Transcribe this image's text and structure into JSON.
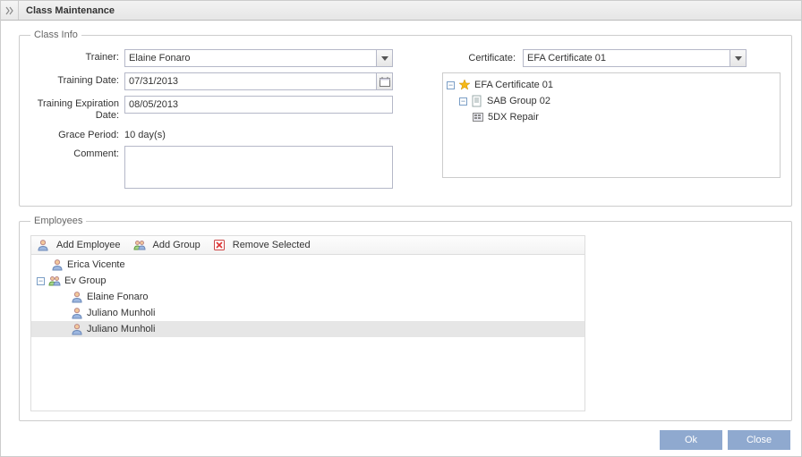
{
  "window": {
    "title": "Class Maintenance"
  },
  "classInfo": {
    "legend": "Class Info",
    "trainer_label": "Trainer:",
    "trainer_value": "Elaine Fonaro",
    "training_date_label": "Training Date:",
    "training_date_value": "07/31/2013",
    "expiry_label": "Training Expiration Date:",
    "expiry_value": "08/05/2013",
    "grace_label": "Grace Period:",
    "grace_value": "10 day(s)",
    "comment_label": "Comment:",
    "comment_value": "",
    "certificate_label": "Certificate:",
    "certificate_value": "EFA Certificate 01",
    "cert_tree": {
      "root": "EFA Certificate 01",
      "group": "SAB Group 02",
      "item": "5DX Repair"
    }
  },
  "employees": {
    "legend": "Employees",
    "add_employee": "Add Employee",
    "add_group": "Add Group",
    "remove_selected": "Remove Selected",
    "tree": {
      "person1": "Erica Vicente",
      "group": "Ev Group",
      "child1": "Elaine Fonaro",
      "child2": "Juliano Munholi",
      "child3": "Juliano Munholi"
    }
  },
  "footer": {
    "ok": "Ok",
    "close": "Close"
  }
}
